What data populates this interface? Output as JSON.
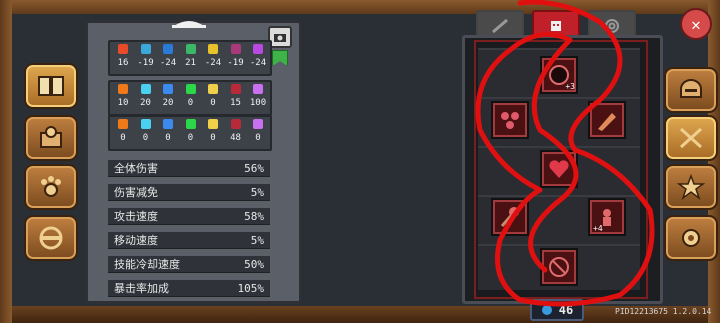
{
  "resources_row1": [
    {
      "icon": "fire-icon",
      "color": "#e84a2a",
      "value": "16"
    },
    {
      "icon": "ice-icon",
      "color": "#3aa8d8",
      "value": "-19"
    },
    {
      "icon": "lightning-icon",
      "color": "#2a7ad8",
      "value": "-24"
    },
    {
      "icon": "poison-icon",
      "color": "#3ab868",
      "value": "21"
    },
    {
      "icon": "light-icon",
      "color": "#e8c22a",
      "value": "-24"
    },
    {
      "icon": "dark-icon",
      "color": "#a83a7a",
      "value": "-19"
    },
    {
      "icon": "arcane-icon",
      "color": "#b84ae0",
      "value": "-24"
    }
  ],
  "resources_row2": [
    {
      "icon": "fire-icon",
      "color": "#f07a1a",
      "value": "10"
    },
    {
      "icon": "ice-icon",
      "color": "#4ad0f0",
      "value": "20"
    },
    {
      "icon": "lightning-icon",
      "color": "#3a8af0",
      "value": "20"
    },
    {
      "icon": "poison-icon",
      "color": "#2ad84a",
      "value": "0"
    },
    {
      "icon": "light-icon",
      "color": "#f0d04a",
      "value": "0"
    },
    {
      "icon": "dark-icon",
      "color": "#b82a3a",
      "value": "15"
    },
    {
      "icon": "arcane-icon",
      "color": "#c870f0",
      "value": "100"
    }
  ],
  "resources_row3": [
    {
      "icon": "fire-icon",
      "color": "#f07a1a",
      "value": "0"
    },
    {
      "icon": "ice-icon",
      "color": "#4ad0f0",
      "value": "0"
    },
    {
      "icon": "lightning-icon",
      "color": "#3a8af0",
      "value": "0"
    },
    {
      "icon": "poison-icon",
      "color": "#2ad84a",
      "value": "0"
    },
    {
      "icon": "light-icon",
      "color": "#f0d04a",
      "value": "0"
    },
    {
      "icon": "dark-icon",
      "color": "#b82a3a",
      "value": "48"
    },
    {
      "icon": "arcane-icon",
      "color": "#c870f0",
      "value": "0"
    }
  ],
  "stats": [
    {
      "label": "全体伤害",
      "value": "56%"
    },
    {
      "label": "伤害减免",
      "value": "5%"
    },
    {
      "label": "攻击速度",
      "value": "58%"
    },
    {
      "label": "移动速度",
      "value": "5%"
    },
    {
      "label": "技能冷却速度",
      "value": "50%"
    },
    {
      "label": "暴击率加成",
      "value": "105%"
    }
  ],
  "skills": {
    "top_badge": "+3",
    "right_badge": "+4"
  },
  "gem_count": "46",
  "version": "PID12213675 1.2.0.14",
  "colors": {
    "accent_red": "#d61010",
    "panel": "#5b6068"
  }
}
